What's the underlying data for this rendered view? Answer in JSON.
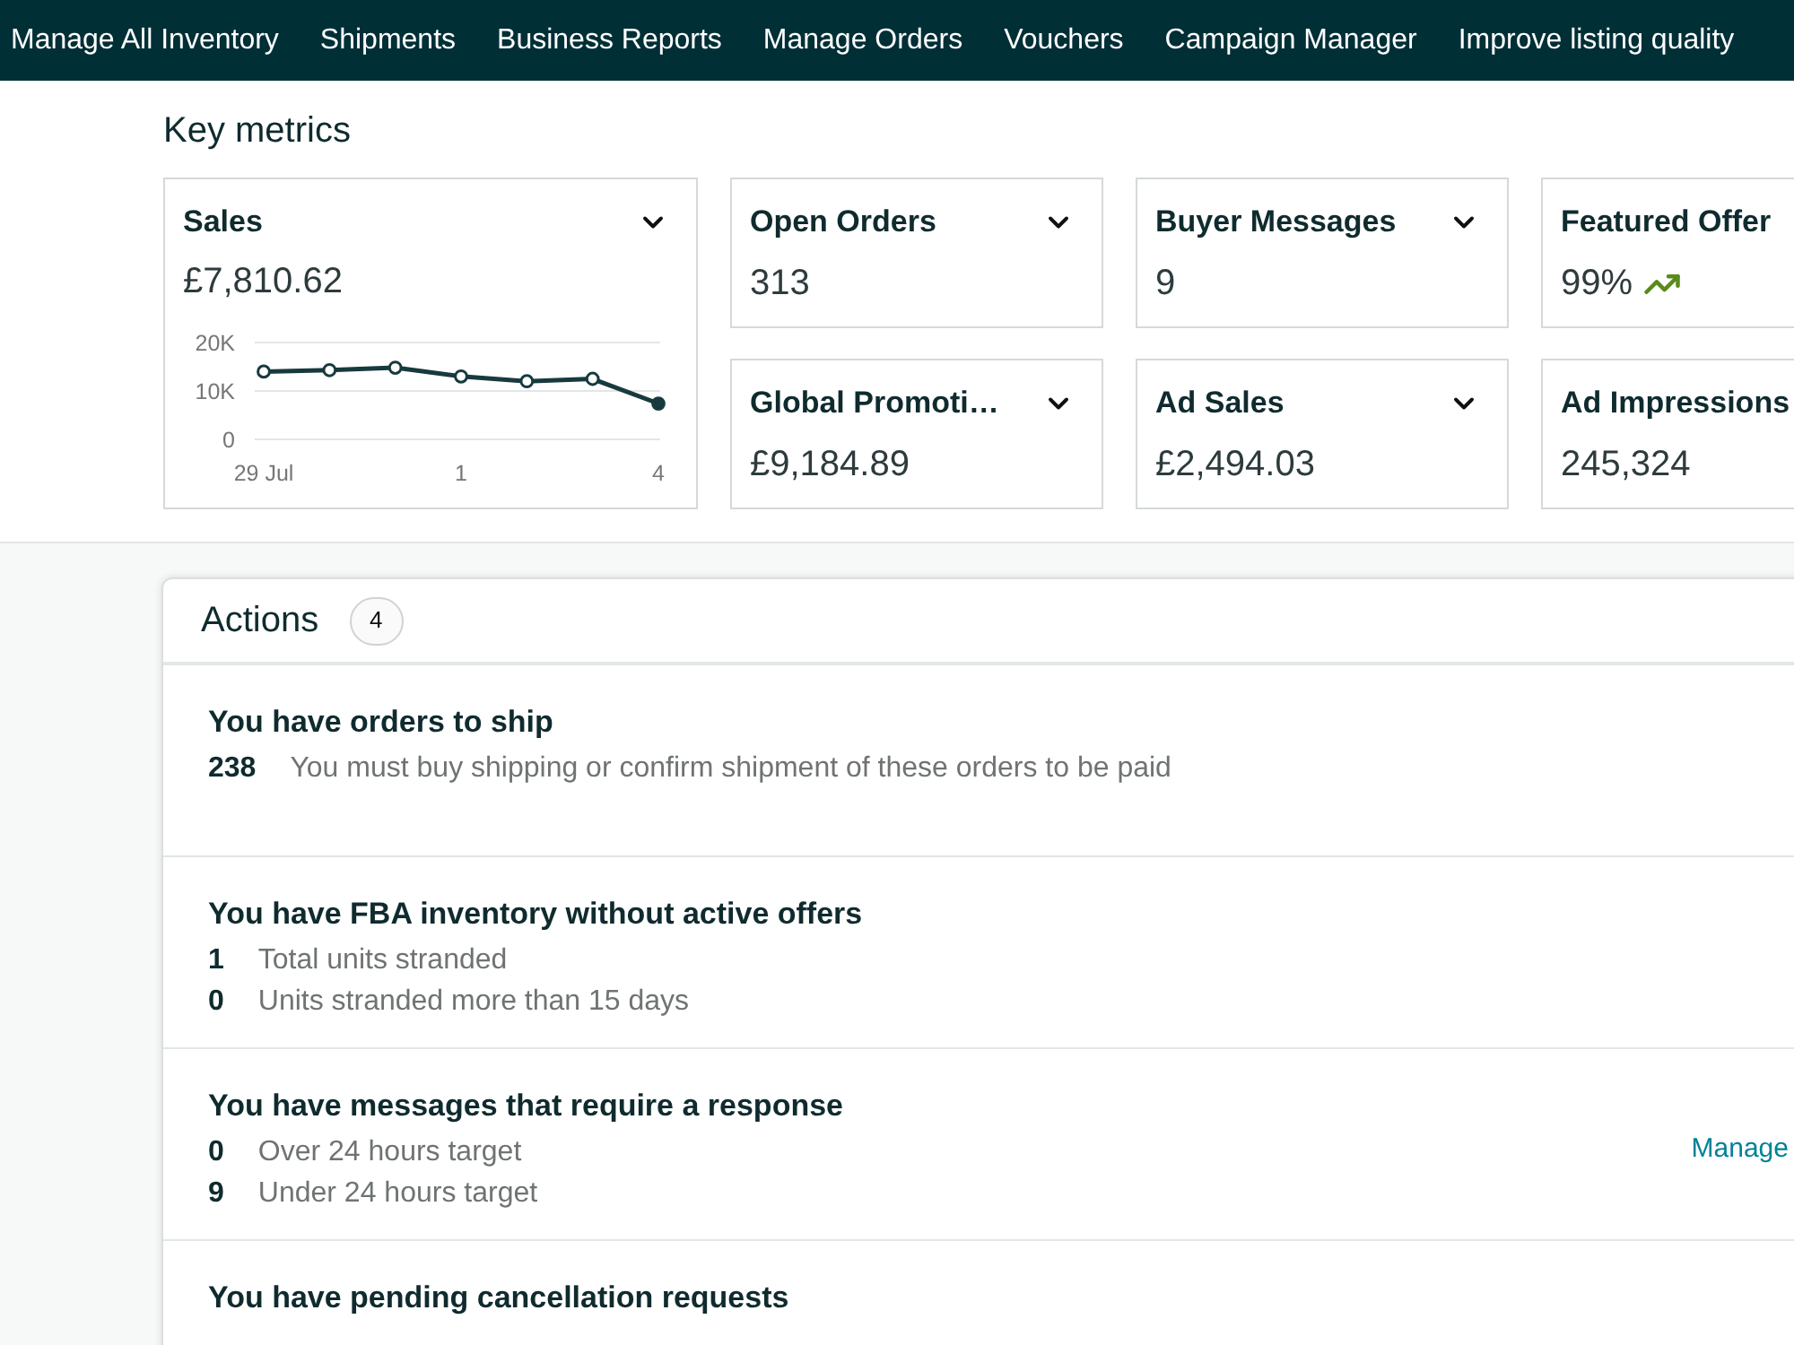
{
  "nav": {
    "items": [
      "Manage All Inventory",
      "Shipments",
      "Business Reports",
      "Manage Orders",
      "Vouchers",
      "Campaign Manager",
      "Improve listing quality"
    ]
  },
  "key_metrics": {
    "title": "Key metrics",
    "sales_card": {
      "title": "Sales",
      "value": "£7,810.62",
      "dropdown": true,
      "chart_data": {
        "type": "line",
        "categories": [
          "29 Jul",
          null,
          null,
          "1",
          null,
          null,
          "4"
        ],
        "ylim": [
          0,
          20000
        ],
        "yticks": [
          {
            "value": 0,
            "label": "0"
          },
          {
            "value": 10000,
            "label": "10K"
          },
          {
            "value": 20000,
            "label": "20K"
          }
        ],
        "series": [
          {
            "color": "#173a3e",
            "marker": "circle",
            "values": [
              14000,
              14300,
              14800,
              13000,
              12000,
              12500,
              7400
            ]
          }
        ]
      }
    },
    "cards": [
      {
        "title": "Open Orders",
        "value": "313",
        "dropdown": true
      },
      {
        "title": "Buyer Messages",
        "value": "9",
        "dropdown": true
      },
      {
        "title": "Featured Offer",
        "value": "99%",
        "trending_up": true
      },
      {
        "title": "Global Promoti…",
        "value": "£9,184.89",
        "dropdown": true
      },
      {
        "title": "Ad Sales",
        "value": "£2,494.03",
        "dropdown": true
      },
      {
        "title": "Ad Impressions",
        "value": "245,324"
      }
    ]
  },
  "actions": {
    "title": "Actions",
    "count": "4",
    "items": [
      {
        "title": "You have orders to ship",
        "lines": [
          {
            "count": "238",
            "text": "You must buy shipping or confirm shipment of these orders to be paid"
          }
        ]
      },
      {
        "title": "You have FBA inventory without active offers",
        "lines": [
          {
            "count": "1",
            "text": "Total units stranded"
          },
          {
            "count": "0",
            "text": "Units stranded more than 15 days"
          }
        ]
      },
      {
        "title": "You have messages that require a response",
        "lines": [
          {
            "count": "0",
            "text": "Over 24 hours target"
          },
          {
            "count": "9",
            "text": "Under 24 hours target"
          }
        ],
        "link": "Manage"
      },
      {
        "title": "You have pending cancellation requests"
      }
    ]
  }
}
